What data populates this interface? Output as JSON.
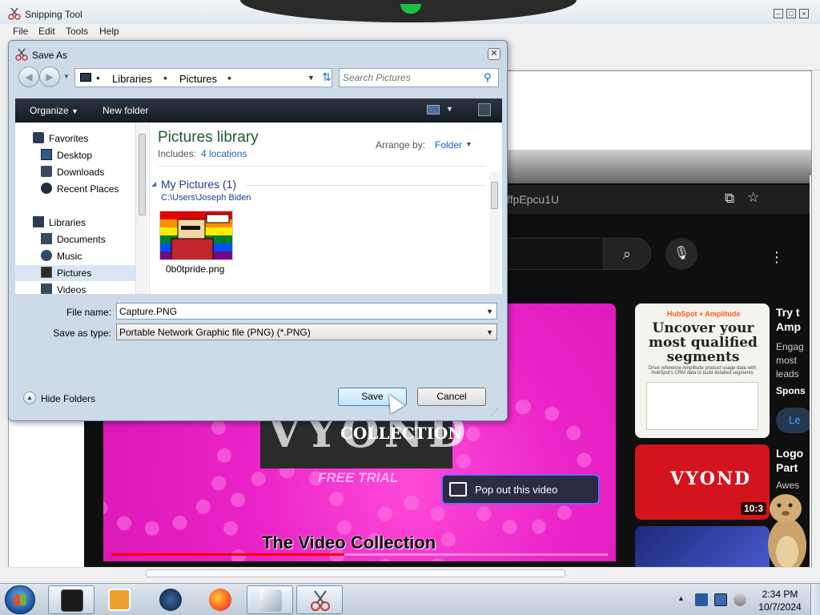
{
  "snipping_tool": {
    "title": "Snipping Tool",
    "menu": [
      "File",
      "Edit",
      "Tools",
      "Help"
    ]
  },
  "youtube": {
    "url_fragment": "ffpEpcu1U",
    "video_title": "The Video Collection",
    "video_logo": "VYOND",
    "video_logo_sub": "COLLECTION",
    "video_free_trial": "FREE TRIAL",
    "video_progress": 0.47,
    "popout_label": "Pop out this video",
    "ad": {
      "brand": "HubSpot + Amplitude",
      "headline": "Uncover your most qualified segments",
      "fine_print": "Drive reference Amplitude product usage data with HubSpot's CRM data to build detailed segments",
      "side_title": "Try t Amp",
      "side_body": "Engag most leads",
      "sponsored": "Spons",
      "learn": "Le"
    },
    "suggested": [
      {
        "title": "Logo Part",
        "meta": "Awes",
        "duration": "10:3",
        "thumb_text": "VYOND"
      }
    ]
  },
  "dialog": {
    "title": "Save As",
    "address": {
      "crumbs": [
        "Libraries",
        "Pictures"
      ]
    },
    "search_placeholder": "Search Pictures",
    "toolbar": {
      "organize": "Organize",
      "new_folder": "New folder"
    },
    "nav_tree": [
      {
        "label": "Favorites",
        "icon": "star-icon"
      },
      {
        "label": "Desktop",
        "icon": "desktop-icon"
      },
      {
        "label": "Downloads",
        "icon": "downloads-icon"
      },
      {
        "label": "Recent Places",
        "icon": "recent-places-icon"
      },
      {
        "label": "Libraries",
        "icon": "libraries-icon"
      },
      {
        "label": "Documents",
        "icon": "documents-icon"
      },
      {
        "label": "Music",
        "icon": "music-icon"
      },
      {
        "label": "Pictures",
        "icon": "pictures-icon"
      },
      {
        "label": "Videos",
        "icon": "videos-icon"
      }
    ],
    "library": {
      "title": "Pictures library",
      "includes_label": "Includes:",
      "locations": "4 locations",
      "arrange_label": "Arrange by:",
      "arrange_value": "Folder"
    },
    "group": {
      "title": "My Pictures (1)",
      "path": "C:\\Users\\Joseph Biden",
      "files": [
        {
          "name": "0b0tpride.png"
        }
      ]
    },
    "file_name_label": "File name:",
    "file_name_value": "Capture.PNG",
    "save_type_label": "Save as type:",
    "save_type_value": "Portable Network Graphic file (PNG) (*.PNG)",
    "hide_folders": "Hide Folders",
    "save_button": "Save",
    "cancel_button": "Cancel"
  },
  "taskbar": {
    "time": "2:34 PM",
    "date": "10/7/2024"
  },
  "colors": {
    "accent_blue": "#1d60b8",
    "library_green": "#1e5b2a",
    "video_pink": "#ea23c8",
    "progress_red": "#ff0000"
  }
}
